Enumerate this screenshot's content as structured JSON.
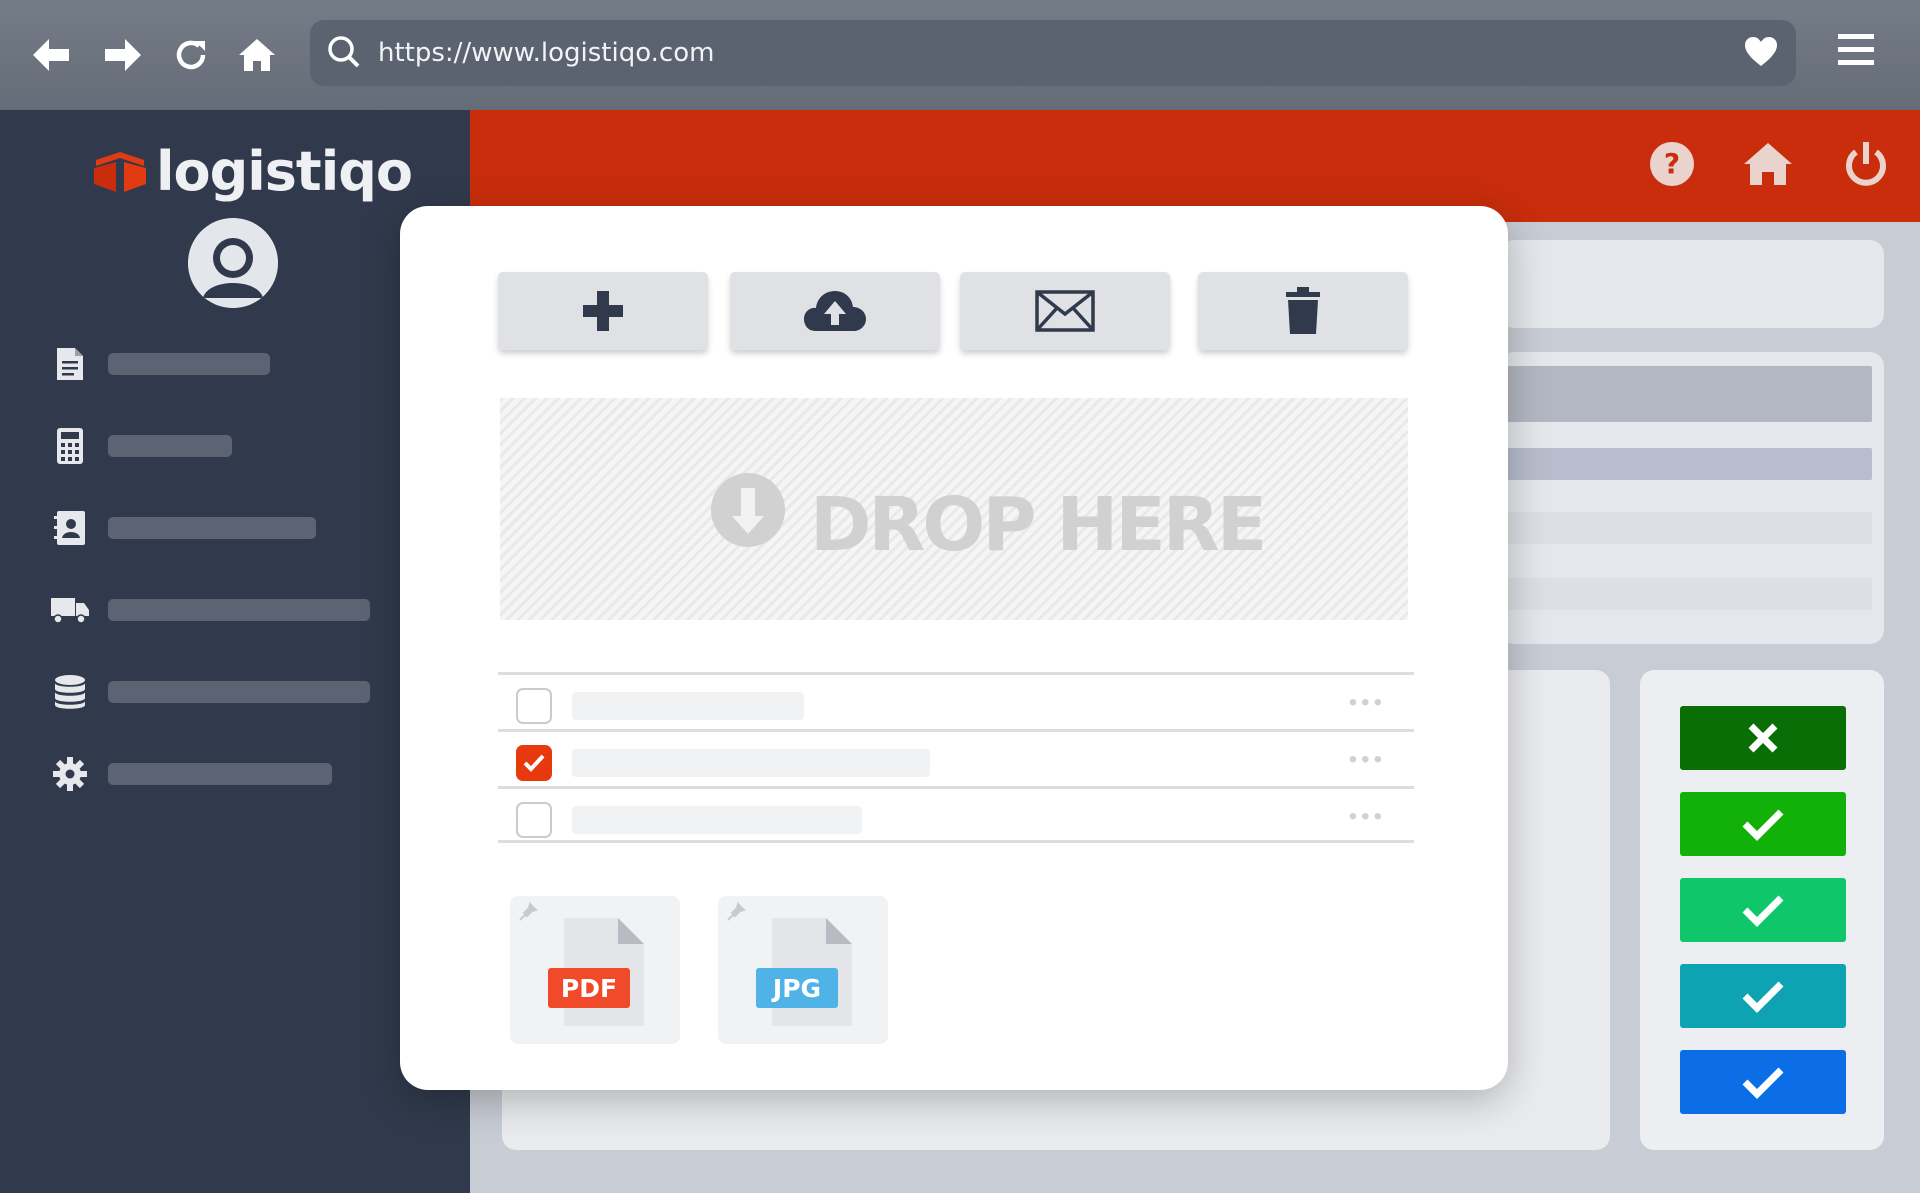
{
  "browser": {
    "url": "https://www.logistiqo.com"
  },
  "brand": {
    "name": "logistiqo",
    "accent": "#c92d0b"
  },
  "sidebar": {
    "items": [
      {
        "icon": "document-icon"
      },
      {
        "icon": "calculator-icon"
      },
      {
        "icon": "contacts-icon"
      },
      {
        "icon": "truck-icon"
      },
      {
        "icon": "database-icon"
      },
      {
        "icon": "gear-icon"
      }
    ]
  },
  "topbar": {
    "icons": [
      "help-icon",
      "home-icon",
      "power-icon"
    ]
  },
  "modal": {
    "toolbar": [
      "add-icon",
      "upload-icon",
      "mail-icon",
      "trash-icon"
    ],
    "dropzone": {
      "label": "DROP HERE"
    },
    "files": [
      {
        "checked": false
      },
      {
        "checked": true
      },
      {
        "checked": false
      }
    ],
    "attachments": [
      {
        "type": "PDF",
        "color": "#f04a2b"
      },
      {
        "type": "JPG",
        "color": "#4fb3e8"
      }
    ]
  },
  "status_buttons": [
    {
      "icon": "close-icon",
      "color": "#0a6e06"
    },
    {
      "icon": "check-icon",
      "color": "#12b109"
    },
    {
      "icon": "check-icon",
      "color": "#0fc76a"
    },
    {
      "icon": "check-icon",
      "color": "#0ea3b3"
    },
    {
      "icon": "check-icon",
      "color": "#0b6ee6"
    }
  ]
}
